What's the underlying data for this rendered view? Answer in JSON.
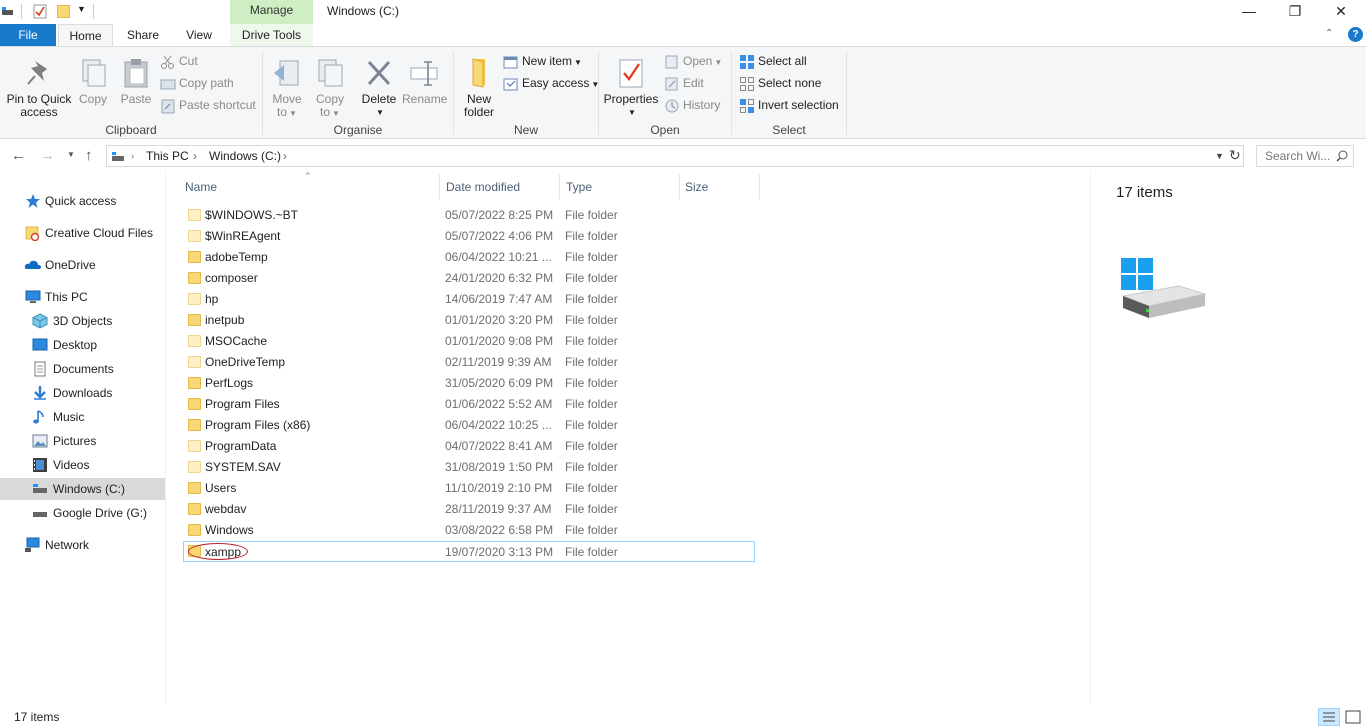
{
  "window": {
    "title": "Windows (C:)",
    "context_tab": "Manage",
    "minimize": "—",
    "maximize": "❐",
    "close": "✕"
  },
  "tabs": {
    "file": "File",
    "home": "Home",
    "share": "Share",
    "view": "View",
    "drive_tools": "Drive Tools"
  },
  "ribbon": {
    "clipboard": {
      "label": "Clipboard",
      "pin_line1": "Pin to Quick",
      "pin_line2": "access",
      "copy": "Copy",
      "paste": "Paste",
      "cut": "Cut",
      "copy_path": "Copy path",
      "paste_shortcut": "Paste shortcut"
    },
    "organise": {
      "label": "Organise",
      "move_to_line1": "Move",
      "move_to_line2": "to",
      "copy_to_line1": "Copy",
      "copy_to_line2": "to",
      "delete": "Delete",
      "rename": "Rename"
    },
    "new": {
      "label": "New",
      "new_folder_line1": "New",
      "new_folder_line2": "folder",
      "new_item": "New item",
      "easy_access": "Easy access"
    },
    "open": {
      "label": "Open",
      "properties": "Properties",
      "open": "Open",
      "edit": "Edit",
      "history": "History"
    },
    "select": {
      "label": "Select",
      "select_all": "Select all",
      "select_none": "Select none",
      "invert_selection": "Invert selection"
    }
  },
  "address": {
    "crumbs": [
      "This PC",
      "Windows (C:)"
    ],
    "search_placeholder": "Search Wi..."
  },
  "nav_pane": {
    "items": [
      {
        "label": "Quick access",
        "icon": "star-icon"
      },
      {
        "label": "Creative Cloud Files",
        "icon": "creative-cloud-icon"
      },
      {
        "label": "OneDrive",
        "icon": "cloud-icon"
      },
      {
        "label": "This PC",
        "icon": "computer-icon"
      },
      {
        "label": "3D Objects",
        "icon": "cube-icon"
      },
      {
        "label": "Desktop",
        "icon": "desktop-icon"
      },
      {
        "label": "Documents",
        "icon": "documents-icon"
      },
      {
        "label": "Downloads",
        "icon": "download-icon"
      },
      {
        "label": "Music",
        "icon": "music-icon"
      },
      {
        "label": "Pictures",
        "icon": "pictures-icon"
      },
      {
        "label": "Videos",
        "icon": "videos-icon"
      },
      {
        "label": "Windows (C:)",
        "icon": "drive-icon"
      },
      {
        "label": "Google Drive (G:)",
        "icon": "drive-icon"
      },
      {
        "label": "Network",
        "icon": "network-icon"
      }
    ]
  },
  "columns": {
    "name": "Name",
    "date": "Date modified",
    "type": "Type",
    "size": "Size"
  },
  "files": [
    {
      "name": "$WINDOWS.~BT",
      "date": "05/07/2022 8:25 PM",
      "type": "File folder"
    },
    {
      "name": "$WinREAgent",
      "date": "05/07/2022 4:06 PM",
      "type": "File folder"
    },
    {
      "name": "adobeTemp",
      "date": "06/04/2022 10:21 ...",
      "type": "File folder"
    },
    {
      "name": "composer",
      "date": "24/01/2020 6:32 PM",
      "type": "File folder"
    },
    {
      "name": "hp",
      "date": "14/06/2019 7:47 AM",
      "type": "File folder"
    },
    {
      "name": "inetpub",
      "date": "01/01/2020 3:20 PM",
      "type": "File folder"
    },
    {
      "name": "MSOCache",
      "date": "01/01/2020 9:08 PM",
      "type": "File folder"
    },
    {
      "name": "OneDriveTemp",
      "date": "02/11/2019 9:39 AM",
      "type": "File folder"
    },
    {
      "name": "PerfLogs",
      "date": "31/05/2020 6:09 PM",
      "type": "File folder"
    },
    {
      "name": "Program Files",
      "date": "01/06/2022 5:52 AM",
      "type": "File folder"
    },
    {
      "name": "Program Files (x86)",
      "date": "06/04/2022 10:25 ...",
      "type": "File folder"
    },
    {
      "name": "ProgramData",
      "date": "04/07/2022 8:41 AM",
      "type": "File folder"
    },
    {
      "name": "SYSTEM.SAV",
      "date": "31/08/2019 1:50 PM",
      "type": "File folder"
    },
    {
      "name": "Users",
      "date": "11/10/2019 2:10 PM",
      "type": "File folder"
    },
    {
      "name": "webdav",
      "date": "28/11/2019 9:37 AM",
      "type": "File folder"
    },
    {
      "name": "Windows",
      "date": "03/08/2022 6:58 PM",
      "type": "File folder"
    },
    {
      "name": "xampp",
      "date": "19/07/2020 3:13 PM",
      "type": "File folder"
    }
  ],
  "details_pane": {
    "count": "17 items"
  },
  "status": {
    "count": "17 items"
  },
  "colors": {
    "file_tab": "#1979ca",
    "manage_tab": "#cfeec4",
    "selection_border": "#99d1ff",
    "annotation_circle": "#c0202a"
  }
}
